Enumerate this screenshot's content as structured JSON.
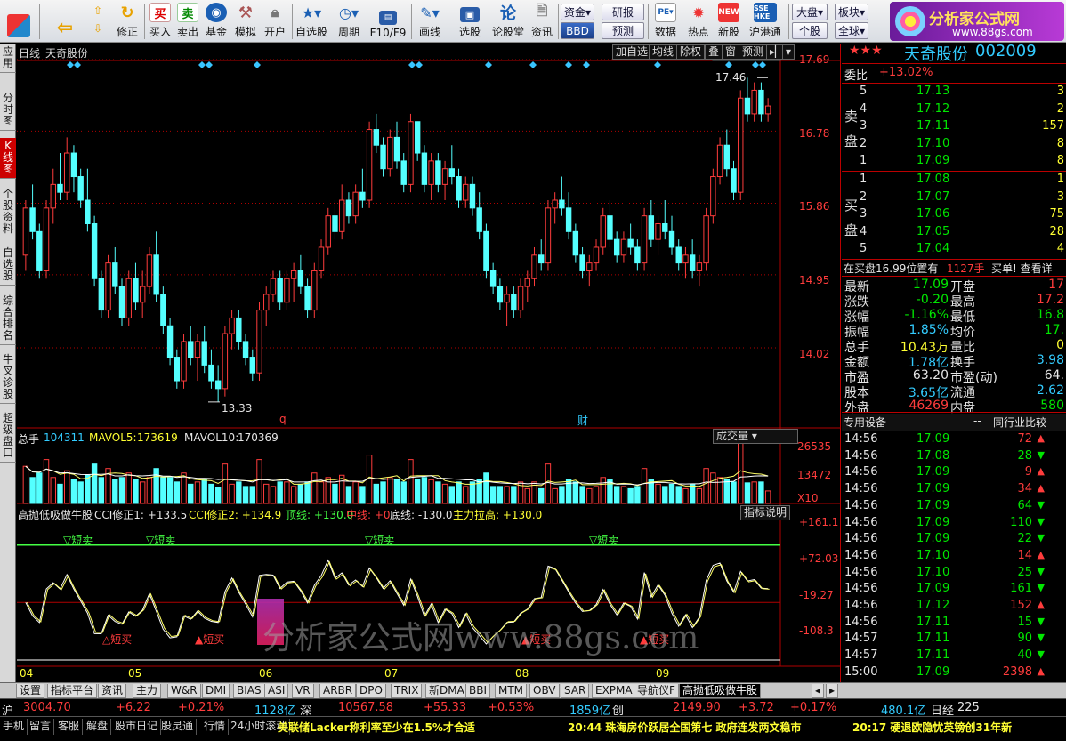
{
  "toolbar": {
    "buttons": [
      {
        "label": "",
        "icon": "grid-icon"
      },
      {
        "label": "",
        "icon": "back-icon"
      },
      {
        "label": "修正",
        "icon": "refresh-icon"
      },
      {
        "label": "买入",
        "icon": "buy-icon"
      },
      {
        "label": "卖出",
        "icon": "sell-icon"
      },
      {
        "label": "基金",
        "icon": "fund-icon"
      },
      {
        "label": "模拟",
        "icon": "simulate-icon"
      },
      {
        "label": "开户",
        "icon": "lock-icon"
      },
      {
        "label": "自选股",
        "icon": "star-icon"
      },
      {
        "label": "周期",
        "icon": "clock-icon"
      },
      {
        "label": "F10/F9",
        "icon": "f10-icon"
      },
      {
        "label": "画线",
        "icon": "pen-icon"
      },
      {
        "label": "选股",
        "icon": "monitor-icon"
      },
      {
        "label": "论股堂",
        "icon": "discuss-icon"
      },
      {
        "label": "资讯",
        "icon": "doc-icon"
      },
      {
        "label": "数据",
        "icon": "pe-icon"
      },
      {
        "label": "热点",
        "icon": "hot-icon"
      },
      {
        "label": "新股",
        "icon": "ipo-icon"
      },
      {
        "label": "沪港通",
        "icon": "hk-icon"
      }
    ],
    "small_buttons": [
      "资金",
      "BBD",
      "研报",
      "预测",
      "大盘",
      "个股",
      "板块",
      "全球"
    ],
    "logo_text": "分析家公式网",
    "logo_url_text": "www.88gs.com"
  },
  "left_tabs": [
    "应用",
    "分时图",
    "K线图",
    "个股资料",
    "自选股",
    "综合排名",
    "牛叉诊股",
    "超级盘口"
  ],
  "chart_header": {
    "period": "日线",
    "stock_name": "天奇股份",
    "buttons": [
      "加自选",
      "均线",
      "除权",
      "叠",
      "窗",
      "预测"
    ],
    "price_ticks": [
      "17.69",
      "16.78",
      "15.86",
      "14.95",
      "14.02"
    ],
    "high_label": "17.46",
    "low_label": "13.33",
    "markers": [
      "q",
      "财"
    ]
  },
  "volume_panel": {
    "title": "总手",
    "total": "104311",
    "mavol5_label": "MAVOL5:",
    "mavol5": "173619",
    "mavol10_label": "MAVOL10:",
    "mavol10": "170369",
    "dropdown": "成交量",
    "ticks": [
      "26535",
      "13472"
    ],
    "unit": "X10"
  },
  "indicator_panel": {
    "name": "高抛低吸做牛股",
    "cci1": "CCI修正1: +133.5",
    "cci2": "CCI修正2: +134.9",
    "top": "顶线: +130.0",
    "mid": "中线: +0",
    "bottom": "底线: -130.0",
    "main": "主力拉高: +130.0",
    "help_button": "指标说明",
    "ticks": [
      "+161.1",
      "+72.03",
      "-19.27",
      "-108.3"
    ],
    "sell_labels": [
      "短卖",
      "短卖",
      "短卖",
      "短卖"
    ],
    "buy_labels": [
      "短买",
      "短买",
      "短买",
      "短买"
    ]
  },
  "x_axis": [
    "04",
    "05",
    "06",
    "07",
    "08",
    "09"
  ],
  "chart_data": {
    "type": "candlestick",
    "ylim": [
      13.0,
      17.69
    ],
    "x": [
      "04",
      "05",
      "06",
      "07",
      "08",
      "09"
    ],
    "candles": [
      [
        15.2,
        15.9,
        15.0,
        15.8
      ],
      [
        15.8,
        16.1,
        15.4,
        15.5
      ],
      [
        15.5,
        15.6,
        14.9,
        15.0
      ],
      [
        15.0,
        15.9,
        14.9,
        15.8
      ],
      [
        15.8,
        16.3,
        15.6,
        16.1
      ],
      [
        16.1,
        16.5,
        15.9,
        16.0
      ],
      [
        16.0,
        16.7,
        15.9,
        16.5
      ],
      [
        16.5,
        16.6,
        16.0,
        16.2
      ],
      [
        16.2,
        16.3,
        15.8,
        15.9
      ],
      [
        15.9,
        16.3,
        15.5,
        15.6
      ],
      [
        15.6,
        15.7,
        14.8,
        14.9
      ],
      [
        14.9,
        15.0,
        14.4,
        14.5
      ],
      [
        14.5,
        15.2,
        14.4,
        15.1
      ],
      [
        15.1,
        15.3,
        14.7,
        14.8
      ],
      [
        14.8,
        14.9,
        14.3,
        14.4
      ],
      [
        14.4,
        15.0,
        14.3,
        14.9
      ],
      [
        14.9,
        15.1,
        14.5,
        14.6
      ],
      [
        14.6,
        15.0,
        14.4,
        14.8
      ],
      [
        14.8,
        15.3,
        14.7,
        15.2
      ],
      [
        15.2,
        15.5,
        14.6,
        14.7
      ],
      [
        14.7,
        14.8,
        14.2,
        14.3
      ],
      [
        14.3,
        14.4,
        13.8,
        13.9
      ],
      [
        13.9,
        14.0,
        13.5,
        13.6
      ],
      [
        13.6,
        14.2,
        13.5,
        14.1
      ],
      [
        14.1,
        14.3,
        13.8,
        13.9
      ],
      [
        13.9,
        14.2,
        13.6,
        14.1
      ],
      [
        14.1,
        14.3,
        13.7,
        13.8
      ],
      [
        13.8,
        14.0,
        13.5,
        13.6
      ],
      [
        13.6,
        13.8,
        13.33,
        13.5
      ],
      [
        13.5,
        14.3,
        13.4,
        14.2
      ],
      [
        14.2,
        14.5,
        14.0,
        14.4
      ],
      [
        14.4,
        14.5,
        14.0,
        14.1
      ],
      [
        14.1,
        14.2,
        13.8,
        13.9
      ],
      [
        13.9,
        14.0,
        13.6,
        13.7
      ],
      [
        13.7,
        14.6,
        13.6,
        14.5
      ],
      [
        14.5,
        14.8,
        14.3,
        14.7
      ],
      [
        14.7,
        15.0,
        14.6,
        14.9
      ],
      [
        14.9,
        15.0,
        14.5,
        14.6
      ],
      [
        14.6,
        15.0,
        14.5,
        14.9
      ],
      [
        14.9,
        15.1,
        14.6,
        15.0
      ],
      [
        15.0,
        15.2,
        14.7,
        14.8
      ],
      [
        14.8,
        14.9,
        14.4,
        14.5
      ],
      [
        14.5,
        15.1,
        14.4,
        15.0
      ],
      [
        15.0,
        15.4,
        14.9,
        15.3
      ],
      [
        15.3,
        15.8,
        15.2,
        15.7
      ],
      [
        15.7,
        15.9,
        15.4,
        15.5
      ],
      [
        15.5,
        16.1,
        15.4,
        15.9
      ],
      [
        15.9,
        16.0,
        15.6,
        15.7
      ],
      [
        15.7,
        16.1,
        15.6,
        16.0
      ],
      [
        16.0,
        16.3,
        15.8,
        15.9
      ],
      [
        15.9,
        16.9,
        15.8,
        16.8
      ],
      [
        16.8,
        17.0,
        16.5,
        16.6
      ],
      [
        16.6,
        16.7,
        16.2,
        16.3
      ],
      [
        16.3,
        16.8,
        16.2,
        16.7
      ],
      [
        16.7,
        16.9,
        16.3,
        16.4
      ],
      [
        16.4,
        16.5,
        16.0,
        16.1
      ],
      [
        16.1,
        17.0,
        16.0,
        16.9
      ],
      [
        16.9,
        16.9,
        16.4,
        16.5
      ],
      [
        16.5,
        16.6,
        16.0,
        16.1
      ],
      [
        16.1,
        16.5,
        15.9,
        16.4
      ],
      [
        16.4,
        16.5,
        16.0,
        16.1
      ],
      [
        16.1,
        16.4,
        15.9,
        16.3
      ],
      [
        16.3,
        16.6,
        16.1,
        16.2
      ],
      [
        16.2,
        16.3,
        15.8,
        15.9
      ],
      [
        15.9,
        16.2,
        15.8,
        16.1
      ],
      [
        16.1,
        16.2,
        15.7,
        15.8
      ],
      [
        15.8,
        16.0,
        15.4,
        15.5
      ],
      [
        15.5,
        15.6,
        14.9,
        15.0
      ],
      [
        15.0,
        15.1,
        14.7,
        14.8
      ],
      [
        14.8,
        14.9,
        14.5,
        14.6
      ],
      [
        14.6,
        14.8,
        14.3,
        14.7
      ],
      [
        14.7,
        14.8,
        14.4,
        14.5
      ],
      [
        14.5,
        14.9,
        14.4,
        14.8
      ],
      [
        14.8,
        15.0,
        14.6,
        14.9
      ],
      [
        14.9,
        15.3,
        14.8,
        15.2
      ],
      [
        15.2,
        15.4,
        15.0,
        15.1
      ],
      [
        15.1,
        15.9,
        15.0,
        15.8
      ],
      [
        15.8,
        16.0,
        15.6,
        15.9
      ],
      [
        15.9,
        16.2,
        15.7,
        15.8
      ],
      [
        15.8,
        16.0,
        15.4,
        15.5
      ],
      [
        15.5,
        15.6,
        15.1,
        15.2
      ],
      [
        15.2,
        15.3,
        14.9,
        15.0
      ],
      [
        15.0,
        15.2,
        14.8,
        15.1
      ],
      [
        15.1,
        15.4,
        15.0,
        15.3
      ],
      [
        15.3,
        15.8,
        15.2,
        15.7
      ],
      [
        15.7,
        15.9,
        15.3,
        15.4
      ],
      [
        15.4,
        15.5,
        15.1,
        15.2
      ],
      [
        15.2,
        15.5,
        15.1,
        15.4
      ],
      [
        15.4,
        15.6,
        15.2,
        15.3
      ],
      [
        15.3,
        15.4,
        15.0,
        15.1
      ],
      [
        15.1,
        15.8,
        15.0,
        15.7
      ],
      [
        15.7,
        15.9,
        15.3,
        15.4
      ],
      [
        15.4,
        15.7,
        15.2,
        15.6
      ],
      [
        15.6,
        15.9,
        15.4,
        15.5
      ],
      [
        15.5,
        15.7,
        15.2,
        15.3
      ],
      [
        15.3,
        15.4,
        15.0,
        15.1
      ],
      [
        15.1,
        15.3,
        14.9,
        15.2
      ],
      [
        15.2,
        15.4,
        14.9,
        15.0
      ],
      [
        15.0,
        15.2,
        14.8,
        15.1
      ],
      [
        15.1,
        15.8,
        15.0,
        15.7
      ],
      [
        15.7,
        16.3,
        15.6,
        16.2
      ],
      [
        16.2,
        16.7,
        16.1,
        16.6
      ],
      [
        16.6,
        16.8,
        16.2,
        16.3
      ],
      [
        16.3,
        16.4,
        15.9,
        16.0
      ],
      [
        16.0,
        17.3,
        15.9,
        17.2
      ],
      [
        17.2,
        17.46,
        16.9,
        17.0
      ],
      [
        17.0,
        17.4,
        16.9,
        17.3
      ],
      [
        17.3,
        17.4,
        16.9,
        17.0
      ],
      [
        17.0,
        17.2,
        16.9,
        17.1
      ]
    ]
  },
  "quote": {
    "stars": "★★★",
    "name": "天奇股份",
    "code": "002009",
    "weibi_label": "委比",
    "weibi": "+13.02%",
    "sell_label": "卖盘",
    "buy_label": "买盘",
    "asks": [
      {
        "lvl": "5",
        "price": "17.13",
        "vol": "3"
      },
      {
        "lvl": "4",
        "price": "17.12",
        "vol": "2"
      },
      {
        "lvl": "3",
        "price": "17.11",
        "vol": "157"
      },
      {
        "lvl": "2",
        "price": "17.10",
        "vol": "8"
      },
      {
        "lvl": "1",
        "price": "17.09",
        "vol": "8"
      }
    ],
    "bids": [
      {
        "lvl": "1",
        "price": "17.08",
        "vol": "1"
      },
      {
        "lvl": "2",
        "price": "17.07",
        "vol": "3"
      },
      {
        "lvl": "3",
        "price": "17.06",
        "vol": "75"
      },
      {
        "lvl": "4",
        "price": "17.05",
        "vol": "28"
      },
      {
        "lvl": "5",
        "price": "17.04",
        "vol": "4"
      }
    ],
    "notice_left": "在买盘16.99位置有",
    "notice_vol": "1127手",
    "notice_right": "买单! 查看详",
    "stats": [
      {
        "l1": "最新",
        "v1": "17.09",
        "l2": "开盘",
        "v2": "17",
        "c1": "grn",
        "c2": "red"
      },
      {
        "l1": "涨跌",
        "v1": "-0.20",
        "l2": "最高",
        "v2": "17.2",
        "c1": "grn",
        "c2": "red"
      },
      {
        "l1": "涨幅",
        "v1": "-1.16%",
        "l2": "最低",
        "v2": "16.8",
        "c1": "grn",
        "c2": "grn"
      },
      {
        "l1": "振幅",
        "v1": "1.85%",
        "l2": "均价",
        "v2": "17.",
        "c1": "cyn",
        "c2": "grn"
      },
      {
        "l1": "总手",
        "v1": "10.43万",
        "l2": "量比",
        "v2": "0",
        "c1": "yel",
        "c2": "yel"
      },
      {
        "l1": "金额",
        "v1": "1.78亿",
        "l2": "换手",
        "v2": "3.98",
        "c1": "cyn",
        "c2": "cyn"
      },
      {
        "l1": "市盈",
        "v1": "63.20",
        "l2": "市盈(动)",
        "v2": "64.",
        "c1": "wht",
        "c2": "wht"
      },
      {
        "l1": "股本",
        "v1": "3.65亿",
        "l2": "流通",
        "v2": "2.62",
        "c1": "cyn",
        "c2": "cyn"
      },
      {
        "l1": "外盘",
        "v1": "46269",
        "l2": "内盘",
        "v2": "580",
        "c1": "red",
        "c2": "grn"
      }
    ],
    "tick_tab1": "专用设备",
    "tick_tab1_sep": "--",
    "tick_tab2": "同行业比较",
    "ticks": [
      {
        "t": "14:56",
        "p": "17.09",
        "v": "72",
        "dir": "up"
      },
      {
        "t": "14:56",
        "p": "17.08",
        "v": "28",
        "dir": "down"
      },
      {
        "t": "14:56",
        "p": "17.09",
        "v": "9",
        "dir": "up"
      },
      {
        "t": "14:56",
        "p": "17.09",
        "v": "34",
        "dir": "up"
      },
      {
        "t": "14:56",
        "p": "17.09",
        "v": "64",
        "dir": "down"
      },
      {
        "t": "14:56",
        "p": "17.09",
        "v": "110",
        "dir": "down"
      },
      {
        "t": "14:56",
        "p": "17.09",
        "v": "22",
        "dir": "down"
      },
      {
        "t": "14:56",
        "p": "17.10",
        "v": "14",
        "dir": "up"
      },
      {
        "t": "14:56",
        "p": "17.10",
        "v": "25",
        "dir": "down"
      },
      {
        "t": "14:56",
        "p": "17.09",
        "v": "161",
        "dir": "down"
      },
      {
        "t": "14:56",
        "p": "17.12",
        "v": "152",
        "dir": "up"
      },
      {
        "t": "14:56",
        "p": "17.11",
        "v": "15",
        "dir": "down"
      },
      {
        "t": "14:57",
        "p": "17.11",
        "v": "90",
        "dir": "down"
      },
      {
        "t": "14:57",
        "p": "17.11",
        "v": "40",
        "dir": "down"
      },
      {
        "t": "15:00",
        "p": "17.09",
        "v": "2398",
        "dir": "up"
      }
    ],
    "bottom_tabs": [
      "细",
      "诊",
      "分",
      "筹",
      "临",
      "指",
      "财"
    ]
  },
  "bottom_tabs": [
    "设置",
    "指标平台",
    "资讯",
    "主力",
    "W&R",
    "DMI",
    "BIAS",
    "ASI",
    "VR",
    "ARBR",
    "DPO",
    "TRIX",
    "新DMA",
    "BBI",
    "MTM",
    "OBV",
    "SAR",
    "EXPMA",
    "导航仪F",
    "高抛低吸做牛股"
  ],
  "status": {
    "sh_label": "沪",
    "sh_index": "3004.70",
    "sh_chg": "+6.22",
    "sh_pct": "+0.21%",
    "sh_amt": "1128亿",
    "sz_label": "深",
    "sz_index": "10567.58",
    "sz_chg": "+55.33",
    "sz_pct": "+0.53%",
    "sz_amt": "1859亿",
    "cy_label": "创",
    "cy_index": "2149.90",
    "cy_chg": "+3.72",
    "cy_pct": "+0.17%",
    "extra_amt": "480.1亿",
    "rizhi_label": "日经",
    "rizhi": "225"
  },
  "newsbar": {
    "buttons": [
      "手机",
      "留言",
      "客服",
      "解盘",
      "股市日记",
      "股灵通",
      "行情",
      "24小时滚动"
    ],
    "news1": "美联储Lacker称利率至少在1.5%才合适",
    "news2": "20:44 珠海房价跃居全国第七 政府连发两文稳市",
    "news3": "20:17 硬退欧隐忧英镑创31年新"
  },
  "watermark": "分析家公式网www.88gs.com",
  "colors": {
    "up": "#ff3c3c",
    "down": "#54ffff",
    "grid": "#b00000",
    "indicator_top": "#44ff44",
    "accent_yellow": "#ffff33"
  }
}
